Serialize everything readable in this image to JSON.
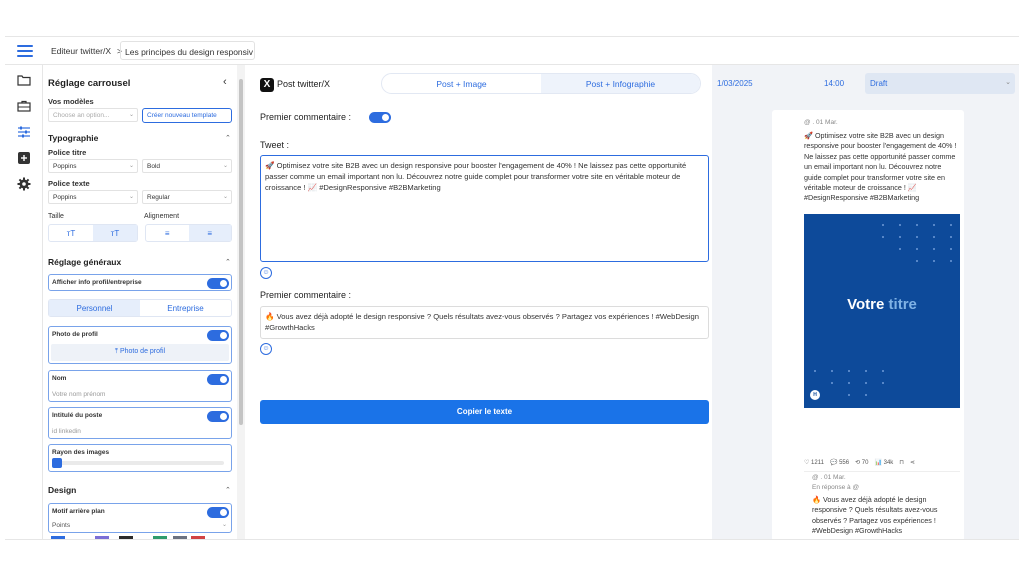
{
  "topbar": {
    "crumb1": "Editeur twitter/X",
    "crumb_sep": ">",
    "crumb2": "Les principes du design responsiv"
  },
  "panel": {
    "title": "Réglage carrousel",
    "models_label": "Vos modèles",
    "models_placeholder": "Choose an option...",
    "new_template_button": "Créer nouveau template",
    "typography_section": "Typographie",
    "title_font_label": "Police titre",
    "title_font": "Poppins",
    "title_weight": "Bold",
    "text_font_label": "Police texte",
    "text_font": "Poppins",
    "text_weight": "Regular",
    "size_label": "Taille",
    "align_label": "Alignement",
    "general_section": "Réglage généraux",
    "show_profile_label": "Afficher info profil/entreprise",
    "seg_personal": "Personnel",
    "seg_company": "Entreprise",
    "profile_photo_label": "Photo de profil",
    "profile_photo_button": "Photo de profil",
    "name_label": "Nom",
    "name_placeholder": "Votre nom prénom",
    "job_label": "Intitulé du poste",
    "job_placeholder": "id linkedin",
    "radius_label": "Rayon des images",
    "design_section": "Design",
    "bg_pattern_label": "Motif arrière plan",
    "bg_pattern_value": "Points",
    "swatch_colors": [
      "#2d6cdf",
      "#7b6fd6",
      "#2b2b2b",
      "#2f9c6c",
      "#6b7280",
      "#d14343"
    ]
  },
  "editor": {
    "post_title": "Post twitter/X",
    "tab_image": "Post + Image",
    "tab_infographic": "Post + Infographie",
    "first_comment_toggle_label": "Premier commentaire :",
    "tweet_label": "Tweet :",
    "tweet_text": "🚀 Optimisez votre site B2B avec un design responsive pour booster l'engagement de 40% ! Ne laissez pas cette opportunité passer comme un email important non lu. Découvrez notre guide complet pour transformer votre site en véritable moteur de croissance ! 📈 #DesignResponsive #B2BMarketing",
    "comment_label": "Premier commentaire :",
    "comment_text": "🔥 Vous avez déjà adopté le design responsive ? Quels résultats avez-vous observés ? Partagez vos expériences ! #WebDesign #GrowthHacks",
    "copy_button": "Copier le texte",
    "emoji_glyph": "☺"
  },
  "preview": {
    "date": "1/03/2025",
    "time": "14:00",
    "status": "Draft",
    "handle": "@ . 01 Mar.",
    "post_text": "🚀 Optimisez votre site B2B avec un design responsive pour booster l'engagement de 40% ! Ne laissez pas cette opportunité passer comme un email important non lu. Découvrez notre guide complet pour transformer votre site en véritable moteur de croissance ! 📈 #DesignResponsive #B2BMarketing",
    "slide_title_main": "Votre",
    "slide_title_accent": "titre",
    "slide_badge": "H",
    "stat_likes": "♡ 1211",
    "stat_comments": "💬 556",
    "stat_retweets": "⟲ 70",
    "stat_views": "📊 34k",
    "reply_handle": "@ . 01 Mar.",
    "reply_to": "En réponse à @",
    "reply_text": "🔥 Vous avez déjà adopté le design responsive ? Quels résultats avez-vous observés ? Partagez vos expériences ! #WebDesign #GrowthHacks"
  }
}
